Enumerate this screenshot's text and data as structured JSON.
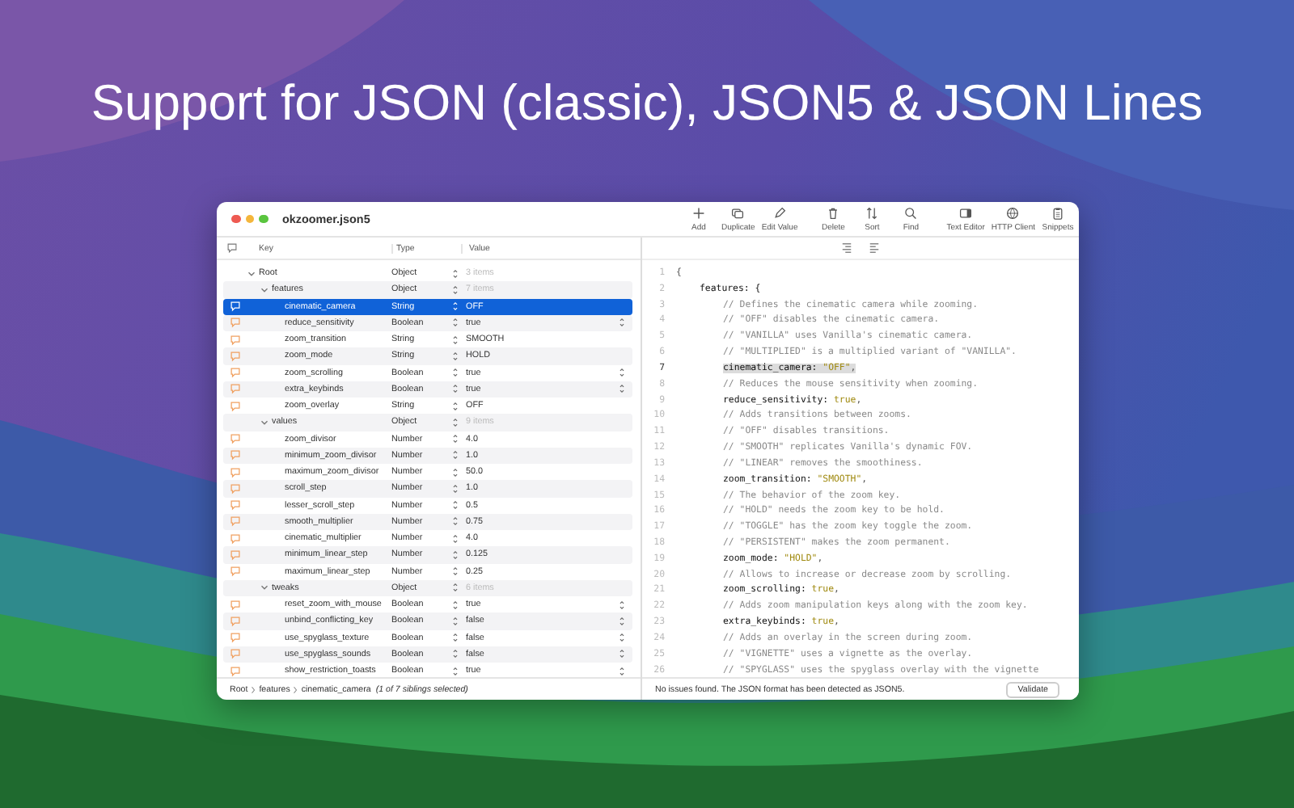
{
  "headline": "Support for JSON (classic), JSON5 & JSON Lines",
  "window": {
    "title": "okzoomer.json5"
  },
  "toolbar": [
    {
      "items": [
        {
          "label": "Add",
          "kind": "plus"
        },
        {
          "label": "Duplicate",
          "kind": "duplicate"
        },
        {
          "label": "Edit Value",
          "kind": "pencil"
        }
      ]
    },
    {
      "items": [
        {
          "label": "Delete",
          "kind": "trash"
        },
        {
          "label": "Sort",
          "kind": "sort"
        },
        {
          "label": "Find",
          "kind": "search"
        }
      ]
    },
    {
      "items": [
        {
          "label": "Text Editor",
          "kind": "sidebar"
        },
        {
          "label": "HTTP Client",
          "kind": "globe"
        },
        {
          "label": "Snippets",
          "kind": "clipboard"
        }
      ]
    }
  ],
  "table": {
    "columns": [
      "Key",
      "Type",
      "Value"
    ],
    "rows": [
      {
        "key": "Root",
        "type": "Object",
        "value": "3 items",
        "kind": "object",
        "expanded": true,
        "selected": false,
        "children": [
          {
            "key": "features",
            "type": "Object",
            "value": "7 items",
            "kind": "object",
            "expanded": true,
            "selected": false,
            "children": [
              {
                "key": "cinematic_camera",
                "type": "String",
                "value": "OFF",
                "kind": "string",
                "selected": true
              },
              {
                "key": "reduce_sensitivity",
                "type": "Boolean",
                "value": "true",
                "kind": "boolean",
                "selected": false
              },
              {
                "key": "zoom_transition",
                "type": "String",
                "value": "SMOOTH",
                "kind": "string",
                "selected": false
              },
              {
                "key": "zoom_mode",
                "type": "String",
                "value": "HOLD",
                "kind": "string",
                "selected": false
              },
              {
                "key": "zoom_scrolling",
                "type": "Boolean",
                "value": "true",
                "kind": "boolean",
                "selected": false
              },
              {
                "key": "extra_keybinds",
                "type": "Boolean",
                "value": "true",
                "kind": "boolean",
                "selected": false
              },
              {
                "key": "zoom_overlay",
                "type": "String",
                "value": "OFF",
                "kind": "string",
                "selected": false
              }
            ]
          },
          {
            "key": "values",
            "type": "Object",
            "value": "9 items",
            "kind": "object",
            "expanded": true,
            "selected": false,
            "children": [
              {
                "key": "zoom_divisor",
                "type": "Number",
                "value": "4.0",
                "kind": "number",
                "selected": false
              },
              {
                "key": "minimum_zoom_divisor",
                "type": "Number",
                "value": "1.0",
                "kind": "number",
                "selected": false
              },
              {
                "key": "maximum_zoom_divisor",
                "type": "Number",
                "value": "50.0",
                "kind": "number",
                "selected": false
              },
              {
                "key": "scroll_step",
                "type": "Number",
                "value": "1.0",
                "kind": "number",
                "selected": false
              },
              {
                "key": "lesser_scroll_step",
                "type": "Number",
                "value": "0.5",
                "kind": "number",
                "selected": false
              },
              {
                "key": "smooth_multiplier",
                "type": "Number",
                "value": "0.75",
                "kind": "number",
                "selected": false
              },
              {
                "key": "cinematic_multiplier",
                "type": "Number",
                "value": "4.0",
                "kind": "number",
                "selected": false
              },
              {
                "key": "minimum_linear_step",
                "type": "Number",
                "value": "0.125",
                "kind": "number",
                "selected": false
              },
              {
                "key": "maximum_linear_step",
                "type": "Number",
                "value": "0.25",
                "kind": "number",
                "selected": false
              }
            ]
          },
          {
            "key": "tweaks",
            "type": "Object",
            "value": "6 items",
            "kind": "object",
            "expanded": true,
            "selected": false,
            "children": [
              {
                "key": "reset_zoom_with_mouse",
                "type": "Boolean",
                "value": "true",
                "kind": "boolean",
                "selected": false
              },
              {
                "key": "unbind_conflicting_key",
                "type": "Boolean",
                "value": "false",
                "kind": "boolean",
                "selected": false
              },
              {
                "key": "use_spyglass_texture",
                "type": "Boolean",
                "value": "false",
                "kind": "boolean",
                "selected": false
              },
              {
                "key": "use_spyglass_sounds",
                "type": "Boolean",
                "value": "false",
                "kind": "boolean",
                "selected": false
              },
              {
                "key": "show_restriction_toasts",
                "type": "Boolean",
                "value": "true",
                "kind": "boolean",
                "selected": false
              }
            ]
          }
        ]
      }
    ]
  },
  "breadcrumb": {
    "items": [
      "Root",
      "features",
      "cinematic_camera"
    ],
    "note": "(1 of 7 siblings selected)"
  },
  "editor": {
    "lines": [
      {
        "number": "1",
        "selected": false,
        "tokens": [
          {
            "kind": "plain",
            "text": "{"
          }
        ],
        "children": [
          {
            "number": "2",
            "selected": false,
            "tokens": [
              {
                "kind": "key",
                "text": "features: {"
              }
            ],
            "children": [
              {
                "number": "3",
                "selected": false,
                "tokens": [
                  {
                    "kind": "comment",
                    "text": "// Defines the cinematic camera while zooming."
                  }
                ]
              },
              {
                "number": "4",
                "selected": false,
                "tokens": [
                  {
                    "kind": "comment",
                    "text": "// \"OFF\" disables the cinematic camera."
                  }
                ]
              },
              {
                "number": "5",
                "selected": false,
                "tokens": [
                  {
                    "kind": "comment",
                    "text": "// \"VANILLA\" uses Vanilla's cinematic camera."
                  }
                ]
              },
              {
                "number": "6",
                "selected": false,
                "tokens": [
                  {
                    "kind": "comment",
                    "text": "// \"MULTIPLIED\" is a multiplied variant of \"VANILLA\"."
                  }
                ]
              },
              {
                "number": "7",
                "selected": true,
                "tokens": [
                  {
                    "kind": "key",
                    "text": "cinematic_camera:"
                  },
                  {
                    "kind": "string",
                    "text": "\"OFF\""
                  },
                  {
                    "kind": "plain",
                    "text": ","
                  }
                ]
              },
              {
                "number": "8",
                "selected": false,
                "tokens": [
                  {
                    "kind": "comment",
                    "text": "// Reduces the mouse sensitivity when zooming."
                  }
                ]
              },
              {
                "number": "9",
                "selected": false,
                "tokens": [
                  {
                    "kind": "key",
                    "text": "reduce_sensitivity:"
                  },
                  {
                    "kind": "string",
                    "text": "true"
                  },
                  {
                    "kind": "plain",
                    "text": ","
                  }
                ]
              },
              {
                "number": "10",
                "selected": false,
                "tokens": [
                  {
                    "kind": "comment",
                    "text": "// Adds transitions between zooms."
                  }
                ]
              },
              {
                "number": "11",
                "selected": false,
                "tokens": [
                  {
                    "kind": "comment",
                    "text": "// \"OFF\" disables transitions."
                  }
                ]
              },
              {
                "number": "12",
                "selected": false,
                "tokens": [
                  {
                    "kind": "comment",
                    "text": "// \"SMOOTH\" replicates Vanilla's dynamic FOV."
                  }
                ]
              },
              {
                "number": "13",
                "selected": false,
                "tokens": [
                  {
                    "kind": "comment",
                    "text": "// \"LINEAR\" removes the smoothiness."
                  }
                ]
              },
              {
                "number": "14",
                "selected": false,
                "tokens": [
                  {
                    "kind": "key",
                    "text": "zoom_transition:"
                  },
                  {
                    "kind": "string",
                    "text": "\"SMOOTH\""
                  },
                  {
                    "kind": "plain",
                    "text": ","
                  }
                ]
              },
              {
                "number": "15",
                "selected": false,
                "tokens": [
                  {
                    "kind": "comment",
                    "text": "// The behavior of the zoom key."
                  }
                ]
              },
              {
                "number": "16",
                "selected": false,
                "tokens": [
                  {
                    "kind": "comment",
                    "text": "// \"HOLD\" needs the zoom key to be hold."
                  }
                ]
              },
              {
                "number": "17",
                "selected": false,
                "tokens": [
                  {
                    "kind": "comment",
                    "text": "// \"TOGGLE\" has the zoom key toggle the zoom."
                  }
                ]
              },
              {
                "number": "18",
                "selected": false,
                "tokens": [
                  {
                    "kind": "comment",
                    "text": "// \"PERSISTENT\" makes the zoom permanent."
                  }
                ]
              },
              {
                "number": "19",
                "selected": false,
                "tokens": [
                  {
                    "kind": "key",
                    "text": "zoom_mode:"
                  },
                  {
                    "kind": "string",
                    "text": "\"HOLD\""
                  },
                  {
                    "kind": "plain",
                    "text": ","
                  }
                ]
              },
              {
                "number": "20",
                "selected": false,
                "tokens": [
                  {
                    "kind": "comment",
                    "text": "// Allows to increase or decrease zoom by scrolling."
                  }
                ]
              },
              {
                "number": "21",
                "selected": false,
                "tokens": [
                  {
                    "kind": "key",
                    "text": "zoom_scrolling:"
                  },
                  {
                    "kind": "string",
                    "text": "true"
                  },
                  {
                    "kind": "plain",
                    "text": ","
                  }
                ]
              },
              {
                "number": "22",
                "selected": false,
                "tokens": [
                  {
                    "kind": "comment",
                    "text": "// Adds zoom manipulation keys along with the zoom key."
                  }
                ]
              },
              {
                "number": "23",
                "selected": false,
                "tokens": [
                  {
                    "kind": "key",
                    "text": "extra_keybinds:"
                  },
                  {
                    "kind": "string",
                    "text": "true"
                  },
                  {
                    "kind": "plain",
                    "text": ","
                  }
                ]
              },
              {
                "number": "24",
                "selected": false,
                "tokens": [
                  {
                    "kind": "comment",
                    "text": "// Adds an overlay in the screen during zoom."
                  }
                ]
              },
              {
                "number": "25",
                "selected": false,
                "tokens": [
                  {
                    "kind": "comment",
                    "text": "// \"VIGNETTE\" uses a vignette as the overlay."
                  }
                ]
              },
              {
                "number": "26",
                "selected": false,
                "tokens": [
                  {
                    "kind": "comment",
                    "text": "// \"SPYGLASS\" uses the spyglass overlay with the vignette"
                  }
                ]
              }
            ]
          }
        ]
      }
    ]
  },
  "validation": {
    "message": "No issues found. The JSON format has been detected as JSON5.",
    "button": "Validate"
  }
}
